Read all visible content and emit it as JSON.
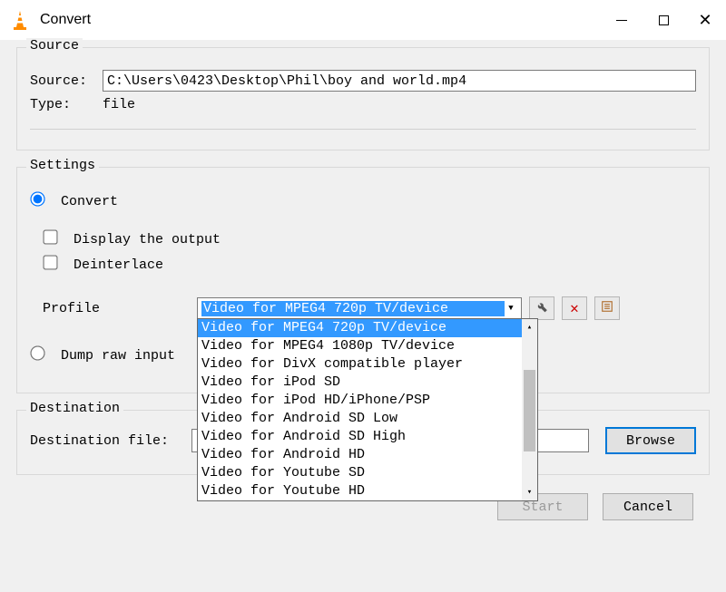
{
  "window": {
    "title": "Convert"
  },
  "source": {
    "legend": "Source",
    "source_label": "Source:",
    "source_value": "C:\\Users\\0423\\Desktop\\Phil\\boy and world.mp4",
    "type_label": "Type:",
    "type_value": "file"
  },
  "settings": {
    "legend": "Settings",
    "convert_label": "Convert",
    "display_output_label": "Display the output",
    "deinterlace_label": "Deinterlace",
    "profile_label": "Profile",
    "profile_selected": "Video for MPEG4 720p TV/device",
    "profile_options": [
      "Video for MPEG4 720p TV/device",
      "Video for MPEG4 1080p TV/device",
      "Video for DivX compatible player",
      "Video for iPod SD",
      "Video for iPod HD/iPhone/PSP",
      "Video for Android SD Low",
      "Video for Android SD High",
      "Video for Android HD",
      "Video for Youtube SD",
      "Video for Youtube HD"
    ],
    "dump_label": "Dump raw input"
  },
  "destination": {
    "legend": "Destination",
    "file_label": "Destination file:",
    "file_value": "",
    "browse_label": "Browse"
  },
  "footer": {
    "start_label": "Start",
    "cancel_label": "Cancel"
  }
}
